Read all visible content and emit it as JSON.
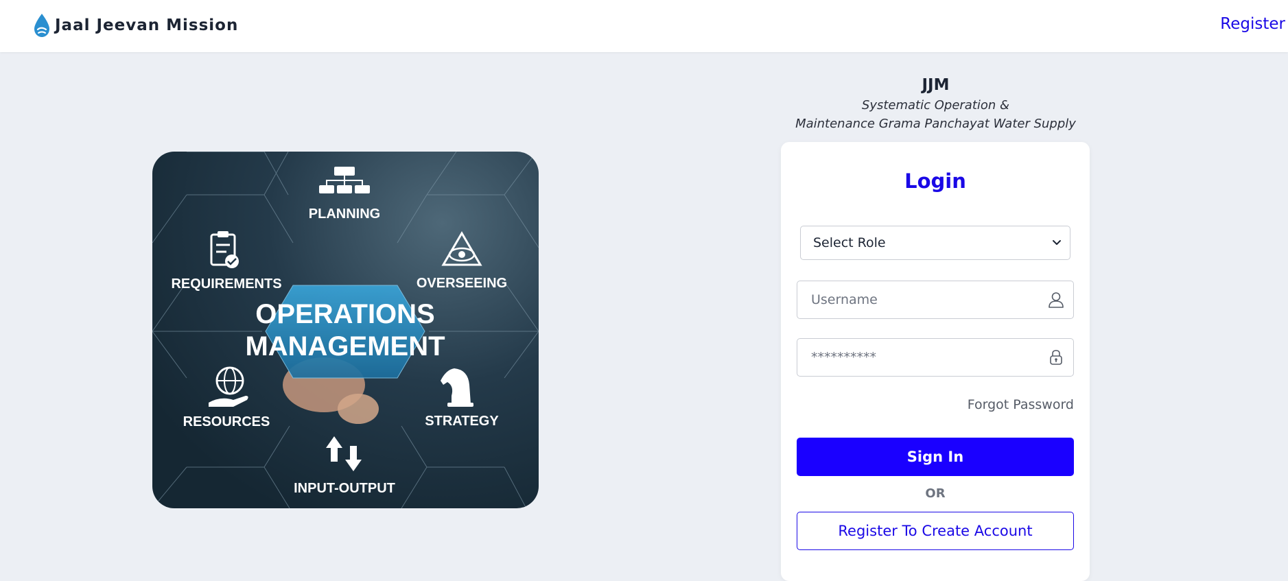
{
  "navbar": {
    "brand_name": "Jaal Jeevan Mission",
    "logo_icon": "water-drop-icon",
    "register_link": "Register"
  },
  "hero": {
    "center_line1": "OPERATIONS",
    "center_line2": "MANAGEMENT",
    "planning": "PLANNING",
    "requirements": "REQUIREMENTS",
    "overseeing": "OVERSEEING",
    "resources": "RESOURCES",
    "strategy": "STRATEGY",
    "input_output": "INPUT-OUTPUT"
  },
  "header": {
    "app_code": "JJM",
    "desc_line1": "Systematic Operation &",
    "desc_line2": "Maintenance Grama Panchayat Water Supply"
  },
  "login": {
    "title": "Login",
    "role_select_value": "Select Role",
    "username_placeholder": "Username",
    "password_placeholder": "**********",
    "forgot_password": "Forgot Password",
    "sign_in": "Sign In",
    "or": "OR",
    "register_account": "Register To Create Account"
  },
  "colors": {
    "accent": "#1a00ff",
    "link": "#1a08e6",
    "page_bg": "#eceff4",
    "hexagon": "#2b8fc4"
  }
}
